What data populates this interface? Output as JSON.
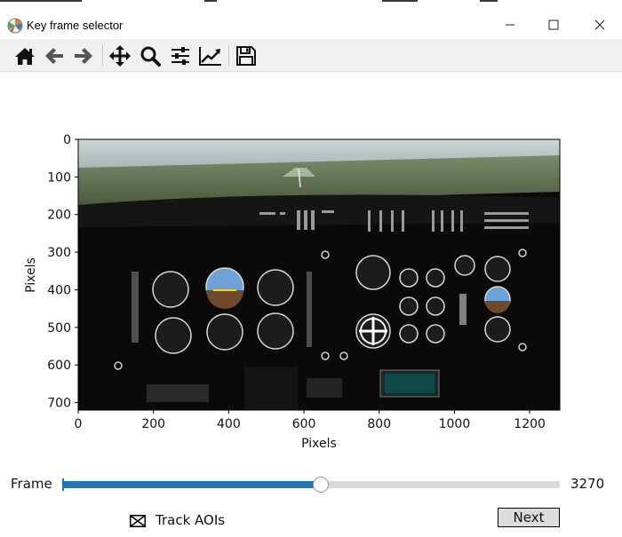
{
  "window": {
    "title": "Key frame selector",
    "app_icon": "matplotlib-icon",
    "controls": [
      "minimize-icon",
      "maximize-icon",
      "close-icon"
    ]
  },
  "toolbar": {
    "buttons": [
      {
        "name": "home-button",
        "icon": "home-icon"
      },
      {
        "name": "back-button",
        "icon": "arrow-left-icon"
      },
      {
        "name": "forward-button",
        "icon": "arrow-right-icon"
      },
      {
        "name": "pan-button",
        "icon": "move-icon"
      },
      {
        "name": "zoom-button",
        "icon": "zoom-icon"
      },
      {
        "name": "subplots-button",
        "icon": "sliders-icon"
      },
      {
        "name": "edit-axes-button",
        "icon": "line-chart-icon"
      },
      {
        "name": "save-button",
        "icon": "save-icon"
      }
    ]
  },
  "plot": {
    "xlabel": "Pixels",
    "ylabel": "Pixels",
    "xticks": [
      "0",
      "200",
      "400",
      "600",
      "800",
      "1000",
      "1200"
    ],
    "yticks": [
      "0",
      "100",
      "200",
      "300",
      "400",
      "500",
      "600",
      "700"
    ],
    "xlim": [
      0,
      1280
    ],
    "ylim": [
      720,
      0
    ],
    "image": "cockpit-view-frame"
  },
  "slider": {
    "label": "Frame",
    "value_label": "3270",
    "fraction": 0.52
  },
  "track_aois": {
    "label": "Track AOIs",
    "checked": true
  },
  "next_button": {
    "label": "Next"
  }
}
